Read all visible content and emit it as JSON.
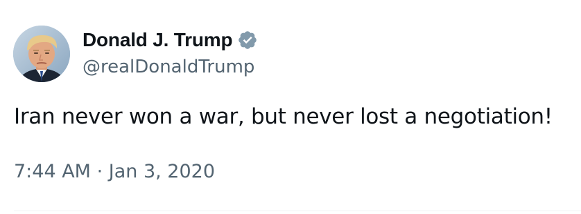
{
  "user": {
    "display_name": "Donald J. Trump",
    "handle": "@realDonaldTrump",
    "verified": true,
    "avatar_icon": "profile-photo"
  },
  "tweet": {
    "text": "Iran never won a war, but never lost a negotiation!",
    "time": "7:44 AM",
    "separator": " · ",
    "date": "Jan 3, 2020"
  },
  "colors": {
    "primary_text": "#0f1419",
    "secondary_text": "#536471",
    "verified_badge": "#829aab",
    "divider": "#eff3f4"
  }
}
